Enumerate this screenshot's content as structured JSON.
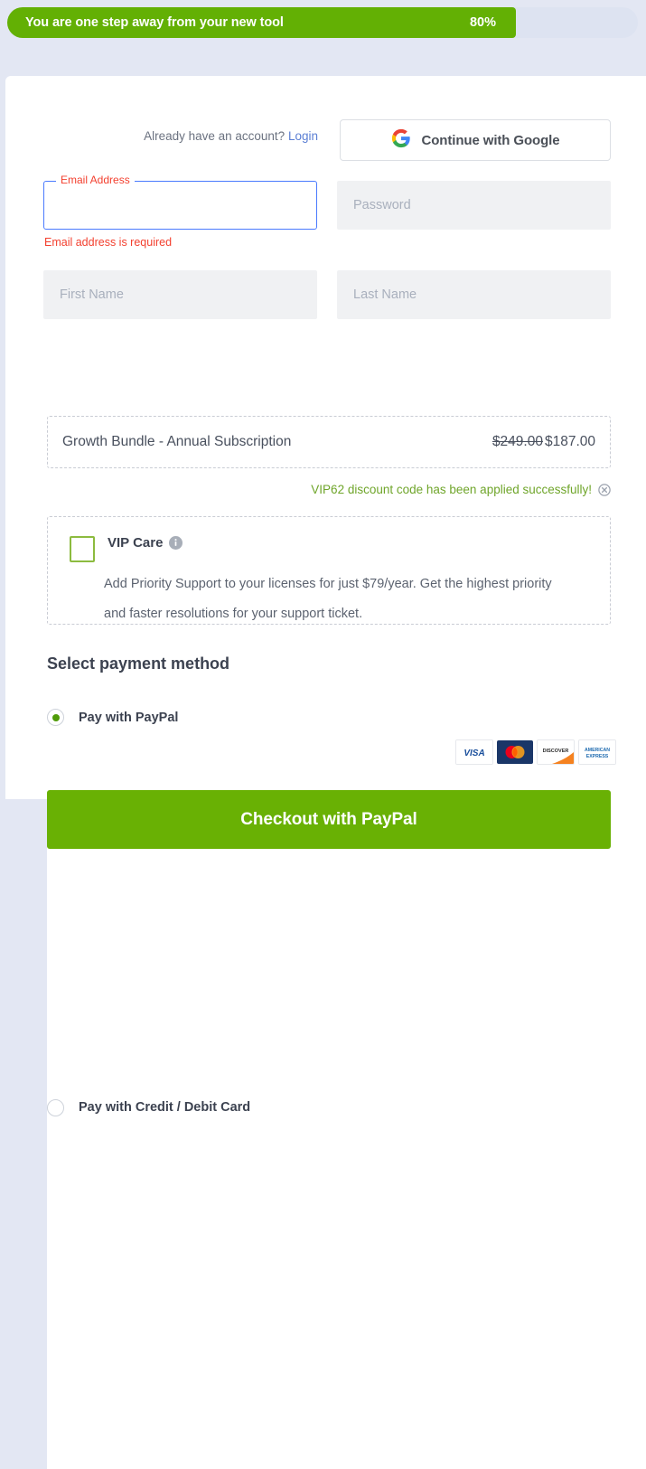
{
  "progress": {
    "label": "You are one step away from your new tool",
    "percent_text": "80%",
    "percent_value": 80,
    "fill_color": "#63b004",
    "track_color": "#dde3f1"
  },
  "account": {
    "prompt": "Already have an account?",
    "login_label": "Login",
    "google_button_label": "Continue with Google",
    "google_icon": "google-g-icon"
  },
  "form": {
    "email": {
      "label": "Email Address",
      "value": "",
      "placeholder": "",
      "error": "Email address is required",
      "state": "focused-error"
    },
    "password": {
      "placeholder": "Password",
      "value": ""
    },
    "first_name": {
      "placeholder": "First Name",
      "value": ""
    },
    "last_name": {
      "placeholder": "Last Name",
      "value": ""
    }
  },
  "product": {
    "name": "Growth Bundle - Annual Subscription",
    "price_original": "$249.00",
    "price_discounted": "$187.00"
  },
  "discount": {
    "message": "VIP62 discount code has been applied successfully!",
    "code": "VIP62",
    "remove_icon": "circle-x-icon",
    "text_color": "#6fa52a"
  },
  "vip_care": {
    "title": "VIP Care",
    "info_icon": "info-icon",
    "checked": false,
    "description_line1": "Add Priority Support to your licenses for just $79/year. Get the",
    "description_line2": "highest priority and faster resolutions for your support ticket."
  },
  "payment": {
    "heading": "Select payment method",
    "options": [
      {
        "label": "Pay with PayPal",
        "selected": true
      },
      {
        "label": "Pay with Credit / Debit Card",
        "selected": false
      }
    ],
    "card_logos": [
      "VISA",
      "MasterCard",
      "DISCOVER",
      "AMERICAN EXPRESS"
    ],
    "checkout_label": "Checkout with PayPal",
    "checkout_color": "#69b104"
  }
}
